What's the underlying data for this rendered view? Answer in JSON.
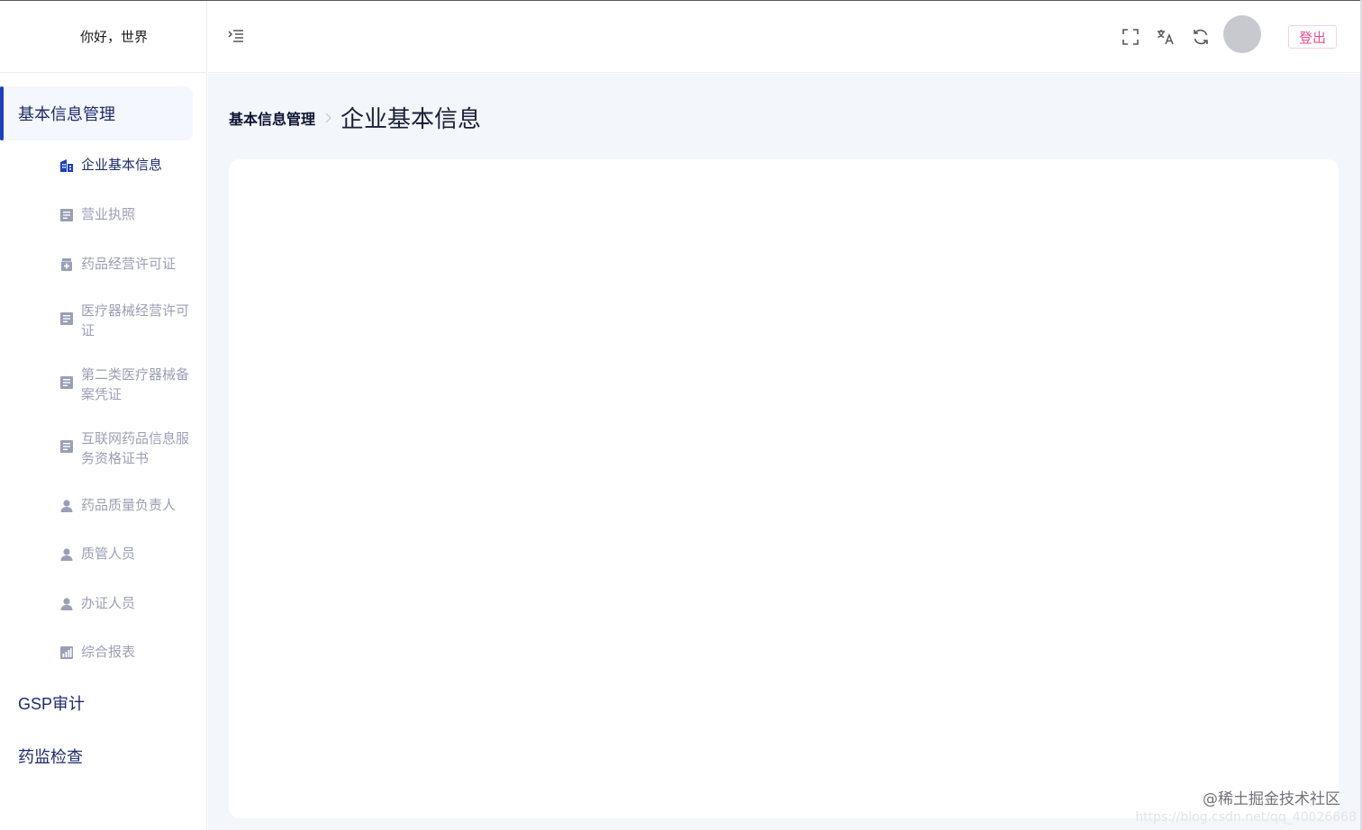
{
  "sidebar": {
    "greeting": "你好，世界",
    "groups": [
      {
        "label": "基本信息管理",
        "active": true
      },
      {
        "label": "GSP审计",
        "active": false
      },
      {
        "label": "药监检查",
        "active": false
      }
    ],
    "submenu": [
      {
        "label": "企业基本信息",
        "icon": "building-icon",
        "active": true
      },
      {
        "label": "营业执照",
        "icon": "document-icon",
        "active": false
      },
      {
        "label": "药品经营许可证",
        "icon": "medicine-icon",
        "active": false
      },
      {
        "label": "医疗器械经营许可证",
        "icon": "document-icon",
        "active": false
      },
      {
        "label": "第二类医疗器械备案凭证",
        "icon": "document-icon",
        "active": false
      },
      {
        "label": "互联网药品信息服务资格证书",
        "icon": "document-icon",
        "active": false
      },
      {
        "label": "药品质量负责人",
        "icon": "user-icon",
        "active": false
      },
      {
        "label": "质管人员",
        "icon": "user-icon",
        "active": false
      },
      {
        "label": "办证人员",
        "icon": "user-icon",
        "active": false
      },
      {
        "label": "综合报表",
        "icon": "chart-icon",
        "active": false
      }
    ]
  },
  "header": {
    "toggle_icon": "menu-fold-icon",
    "icons": [
      "fullscreen-icon",
      "translate-icon",
      "refresh-icon"
    ],
    "logout_label": "登出"
  },
  "breadcrumb": {
    "parent": "基本信息管理",
    "current": "企业基本信息"
  },
  "watermark": {
    "line1": "@稀土掘金技术社区",
    "line2": "https://blog.csdn.net/qq_40026668"
  },
  "colors": {
    "accent": "#1d3fbf",
    "menu_text": "#1d2b6b",
    "muted_text": "#9a9fb5",
    "logout": "#f0508a",
    "main_bg": "#f3f6fb"
  }
}
